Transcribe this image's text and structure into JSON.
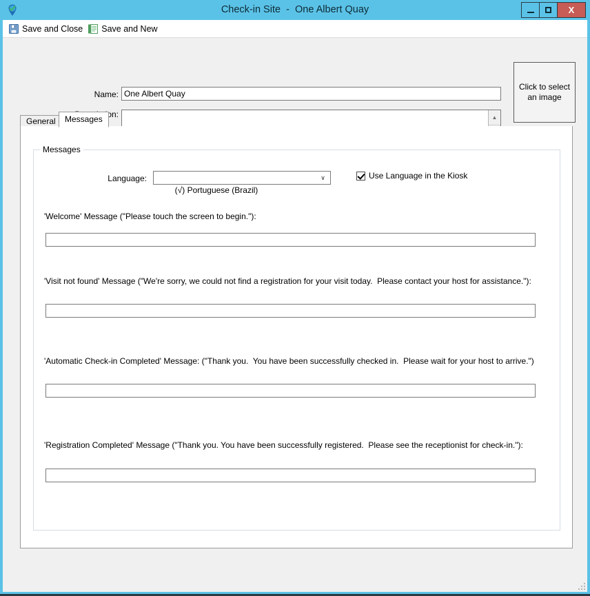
{
  "window": {
    "title": "Check-in Site  -  One Albert Quay",
    "app_icon": "map-pin-check-icon",
    "accent_color": "#5bc2e7",
    "close_color": "#c75b55",
    "controls": {
      "minimize": "–",
      "maximize": "□",
      "close": "X"
    }
  },
  "toolbar": {
    "save_and_close": "Save and Close",
    "save_and_new": "Save and New"
  },
  "header": {
    "name_label": "Name:",
    "name_value": "One Albert Quay",
    "description_label": "Description:",
    "description_value": "",
    "image_placeholder": "Click to select\nan image",
    "spinner_up": "▲",
    "spinner_down": "▼"
  },
  "tabs": [
    {
      "label": "General",
      "active": false
    },
    {
      "label": "Messages",
      "active": true
    }
  ],
  "messages_page": {
    "group_title": "Messages",
    "language_label": "Language:",
    "language_value": "(√) Portuguese (Brazil)",
    "language_arrow": "∨",
    "use_language_checkbox": {
      "label": "Use Language in the Kiosk",
      "checked": true
    },
    "fields": [
      {
        "label": "'Welcome' Message (\"Please touch the screen to begin.\"):",
        "value": ""
      },
      {
        "label": "'Visit not found' Message (\"We're sorry, we could not find a registration for your visit today.  Please contact your host for assistance.\"):",
        "value": ""
      },
      {
        "label": "'Automatic Check-in Completed' Message: (\"Thank you.  You have been successfully checked in.  Please wait for your host to arrive.\")",
        "value": ""
      },
      {
        "label": "'Registration Completed' Message (\"Thank you. You have been successfully registered.  Please see the receptionist for check-in.\"):",
        "value": ""
      }
    ]
  }
}
